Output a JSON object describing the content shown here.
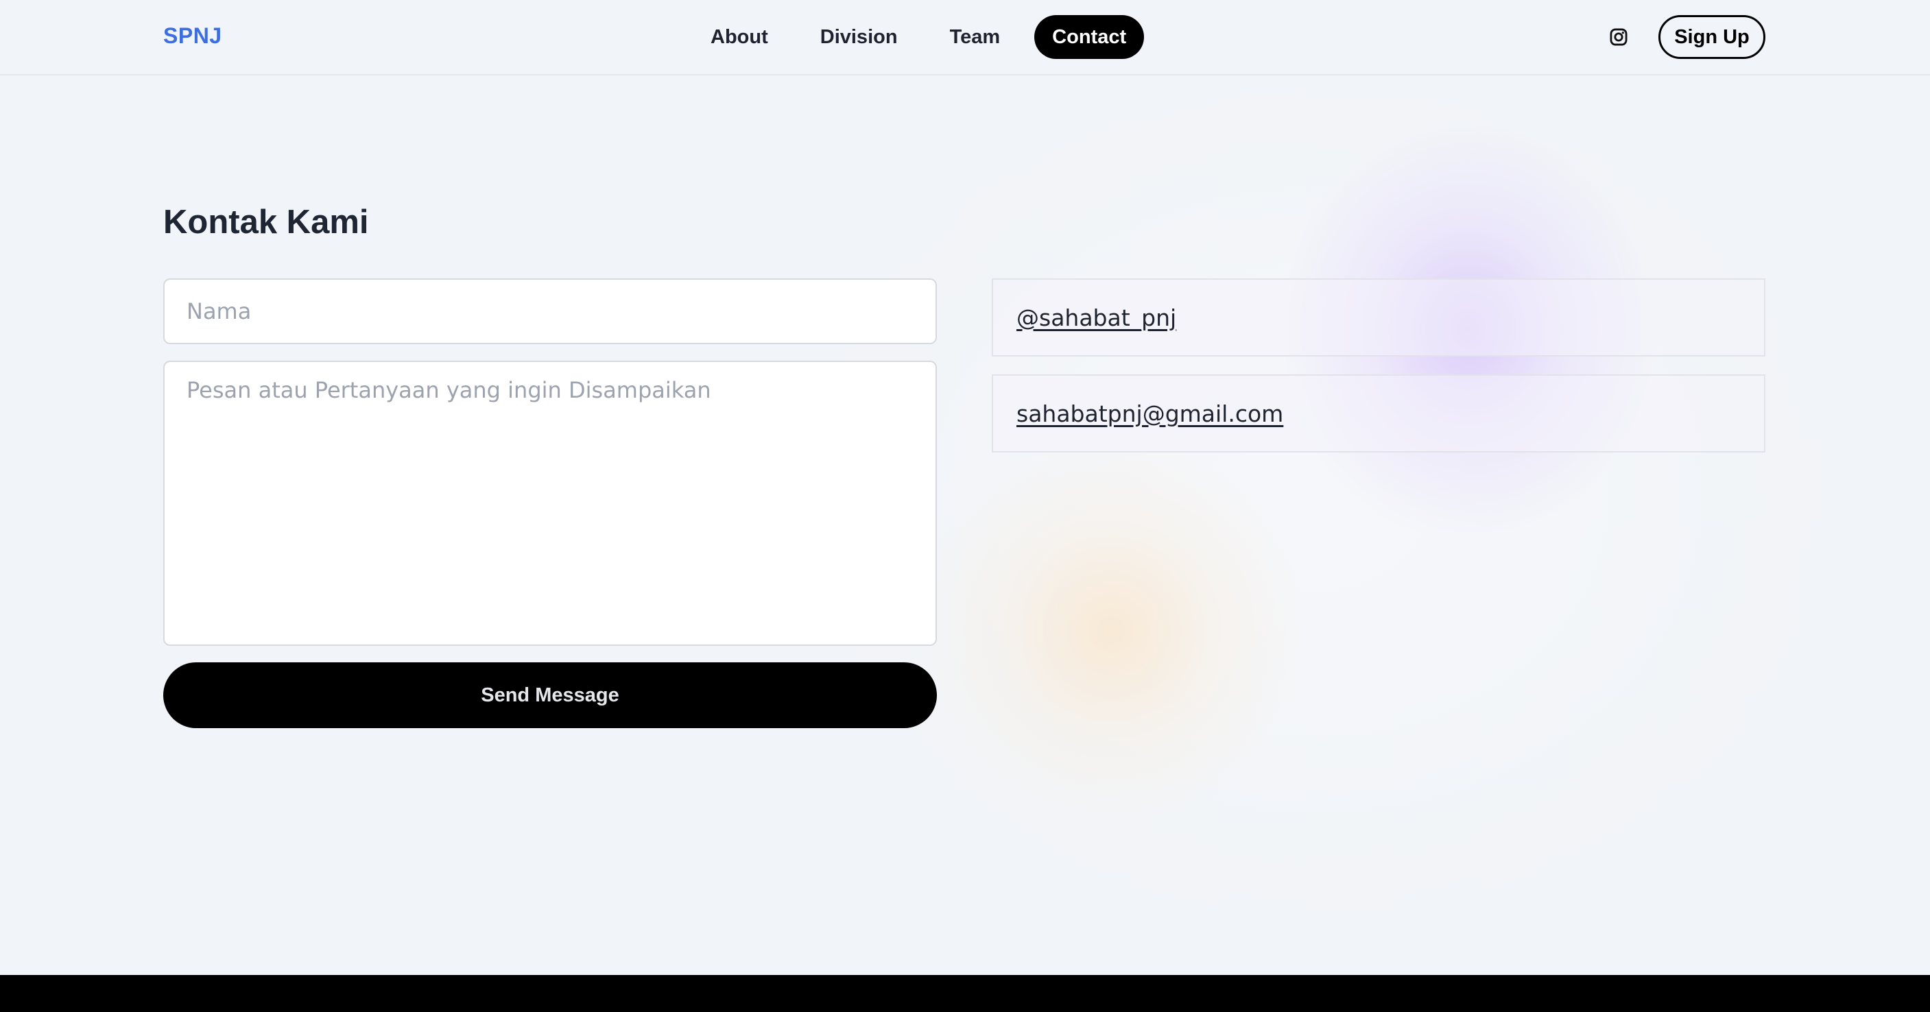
{
  "brand": {
    "name": "SPNJ"
  },
  "nav": {
    "items": [
      {
        "label": "About",
        "active": false
      },
      {
        "label": "Division",
        "active": false
      },
      {
        "label": "Team",
        "active": false
      },
      {
        "label": "Contact",
        "active": true
      }
    ]
  },
  "header": {
    "instagram_icon": "instagram-icon",
    "signup_label": "Sign Up"
  },
  "contact": {
    "title": "Kontak Kami",
    "form": {
      "name_placeholder": "Nama",
      "name_value": "",
      "message_placeholder": "Pesan atau Pertanyaan yang ingin Disampaikan",
      "message_value": "",
      "submit_label": "Send Message"
    },
    "links": {
      "instagram": "@sahabat_pnj",
      "email": "sahabatpnj@gmail.com"
    }
  },
  "colors": {
    "brand": "#3b6ee0",
    "background": "#f1f4f8",
    "button": "#000000",
    "text": "#1e2633"
  }
}
